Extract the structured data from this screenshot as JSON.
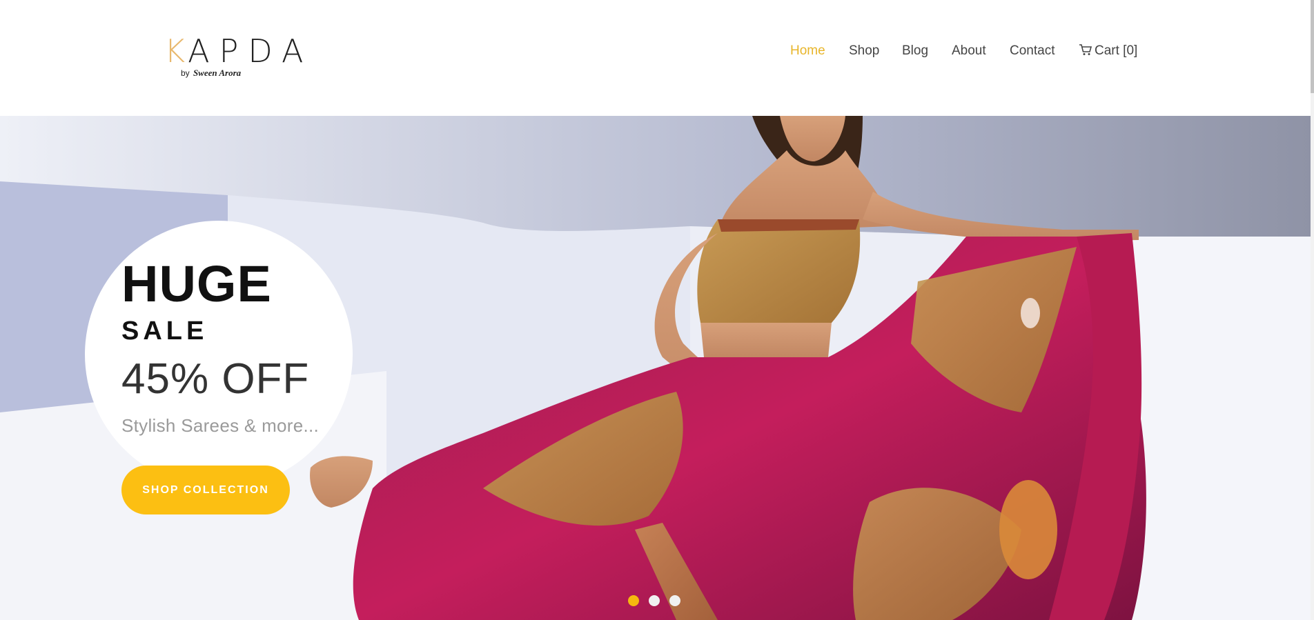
{
  "brand": {
    "logo_text": "APDA",
    "logo_initial": "K",
    "byline_prefix": "by",
    "byline_name": "Sween Arora"
  },
  "nav": {
    "items": [
      {
        "label": "Home",
        "active": true
      },
      {
        "label": "Shop",
        "active": false
      },
      {
        "label": "Blog",
        "active": false
      },
      {
        "label": "About",
        "active": false
      },
      {
        "label": "Contact",
        "active": false
      }
    ],
    "cart_label": "Cart [0]",
    "cart_icon": "shopping-cart-icon",
    "active_color": "#e8b52a"
  },
  "hero": {
    "headline": "HUGE",
    "subheadline": "SALE",
    "discount": "45% OFF",
    "tagline": "Stylish Sarees & more...",
    "cta_label": "SHOP COLLECTION",
    "cta_color": "#fcbf12",
    "slides": 3,
    "active_slide": 1
  }
}
